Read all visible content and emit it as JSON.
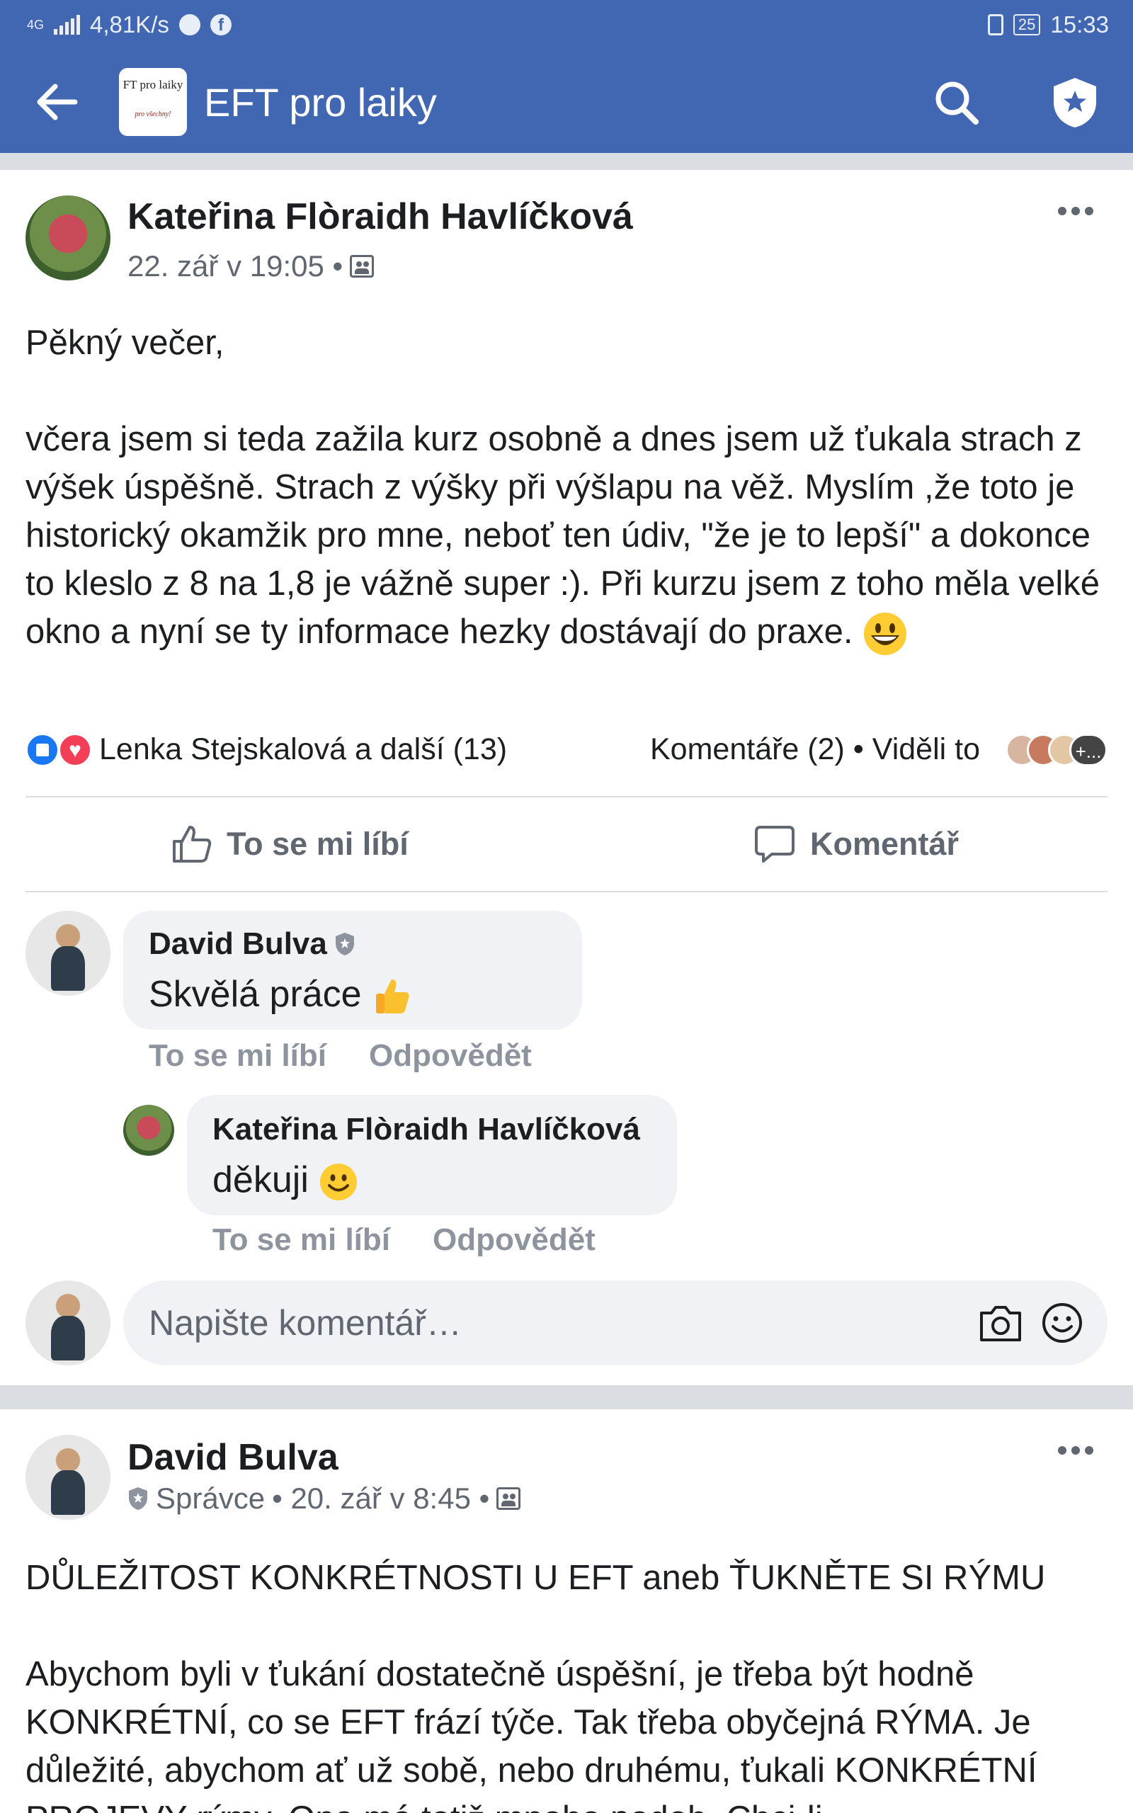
{
  "status_bar": {
    "network": "4G",
    "speed": "4,81K/s",
    "battery": "25",
    "time": "15:33",
    "icons": [
      "signal-icon",
      "messenger-icon",
      "facebook-icon",
      "vibrate-icon",
      "battery-icon"
    ]
  },
  "header": {
    "title": "EFT pro laiky",
    "logo_line1": "FT pro laiky",
    "logo_line2": "pro všechny!",
    "icons": [
      "back-arrow-icon",
      "search-icon",
      "admin-shield-icon"
    ],
    "color": "#4267b2"
  },
  "post1": {
    "author": "Kateřina Flòraidh Havlíčková",
    "date": "22. zář v 19:05 •",
    "text": "Pěkný večer,\n\nvčera jsem si teda zažila kurz osobně a dnes jsem už ťukala strach z výšek úspěšně. Strach z výšky při výšlapu na věž. Myslím ,že toto je historický okamžik pro mne, neboť ten údiv, \"že je to lepší\" a dokonce to kleslo z 8 na 1,8 je vážně super :). Při kurzu jsem z toho měla velké okno a nyní se ty informace hezky dostávají do praxe.",
    "reactions_text": "Lenka Stejskalová a další (13)",
    "comments_text": "Komentáře (2) • Viděli to",
    "seen_more": "+...",
    "like_label": "To se mi líbí",
    "comment_label": "Komentář",
    "comments": [
      {
        "author": "David Bulva",
        "text": "Skvělá práce",
        "like": "To se mi líbí",
        "reply": "Odpovědět"
      },
      {
        "author": "Kateřina Flòraidh Havlíčková",
        "text": "děkuji",
        "like": "To se mi líbí",
        "reply": "Odpovědět"
      }
    ],
    "comment_placeholder": "Napište komentář…"
  },
  "post2": {
    "author": "David Bulva",
    "role": "Správce",
    "date": "• 20. zář v 8:45 •",
    "text": "DŮLEŽITOST KONKRÉTNOSTI U EFT aneb ŤUKNĚTE SI RÝMU\n\nAbychom byli v ťukání dostatečně úspěšní, je třeba být hodně KONKRÉTNÍ, co se EFT frází týče. Tak třeba obyčejná RÝMA. Je důležité, abychom ať už sobě, nebo druhému, ťukali KONKRÉTNÍ PROJEVY rýmy. Ona má totiž mnoho podob. Chci-li"
  }
}
